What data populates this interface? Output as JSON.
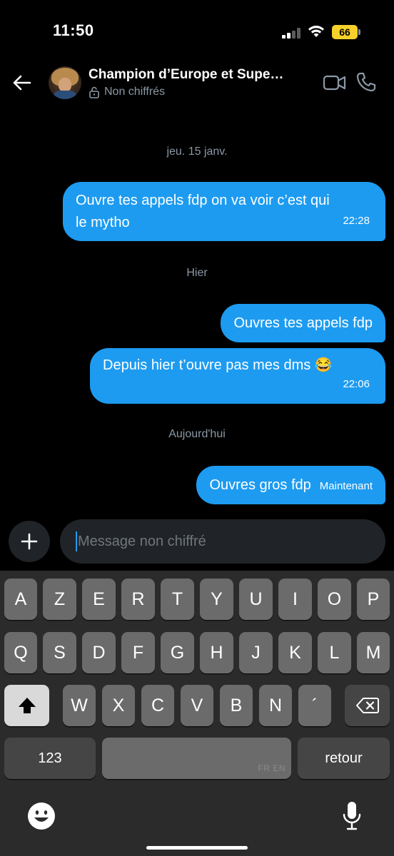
{
  "status_bar": {
    "time": "11:50",
    "battery": "66",
    "colors": {
      "battery": "#f7d12a"
    }
  },
  "header": {
    "back_icon": "arrow-left-icon",
    "title": "Champion d’Europe et Supe…",
    "subtitle": "Non chiffrés",
    "lock_icon": "unlock-icon",
    "video_icon": "video-camera-icon",
    "phone_icon": "phone-icon"
  },
  "messages": [
    {
      "type": "date",
      "text": "jeu. 15 janv."
    },
    {
      "type": "sent",
      "lines": [
        "Ouvre tes appels fdp on va voir c’est qui",
        "le mytho"
      ],
      "time": "22:28"
    },
    {
      "type": "date",
      "text": "Hier"
    },
    {
      "type": "sent",
      "text": "Ouvres tes appels fdp"
    },
    {
      "type": "sent",
      "text": "Depuis hier t’ouvre pas mes dms 😂",
      "time": "22:06"
    },
    {
      "type": "date",
      "text": "Aujourd'hui"
    },
    {
      "type": "sent",
      "text": "Ouvres gros fdp",
      "time": "Maintenant"
    }
  ],
  "composer": {
    "placeholder": "Message non chiffré",
    "plus_icon": "plus-icon"
  },
  "keyboard": {
    "row1": [
      "A",
      "Z",
      "E",
      "R",
      "T",
      "Y",
      "U",
      "I",
      "O",
      "P"
    ],
    "row2": [
      "Q",
      "S",
      "D",
      "F",
      "G",
      "H",
      "J",
      "K",
      "L",
      "M"
    ],
    "row3": [
      "W",
      "X",
      "C",
      "V",
      "B",
      "N",
      "´"
    ],
    "numbers_label": "123",
    "space_languages": "FR EN",
    "return_label": "retour",
    "icons": [
      "shift-icon",
      "backspace-icon",
      "emoji-icon",
      "microphone-icon"
    ]
  },
  "colors": {
    "accent": "#1d9bf0",
    "background": "#000000",
    "muted": "#8b98a5"
  }
}
